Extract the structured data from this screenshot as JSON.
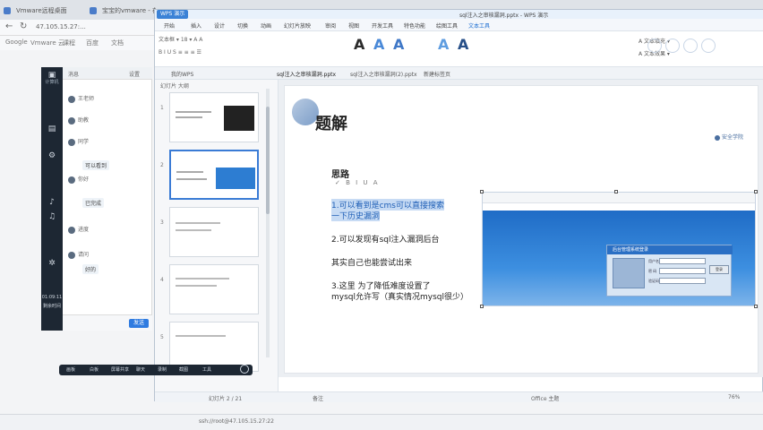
{
  "browser": {
    "tabs": [
      "Vmware远程桌面",
      "宝宝的vmware - 在线课程",
      "搜索..."
    ],
    "address": "47.105.15.27:...",
    "bookmarks": [
      "Google",
      "Vmware 云",
      "课程",
      "百度",
      "文档",
      "Vmware"
    ],
    "status": "ssh://root@47.105.15.27:22"
  },
  "remote_sidebar": {
    "items": [
      {
        "label": "计算机",
        "icon": "monitor-icon"
      },
      {
        "label": "文件",
        "icon": "folder-icon"
      },
      {
        "label": "进程",
        "icon": "process-icon"
      },
      {
        "label": "音量",
        "icon": "speaker-icon"
      },
      {
        "label": "音乐",
        "icon": "music-icon"
      },
      {
        "label": "设置",
        "icon": "gear-icon"
      }
    ],
    "time": "01:09:11",
    "time_label": "剩余时间"
  },
  "chat": {
    "header_left": "消息",
    "header_right": "设置",
    "rows": [
      "王老师",
      "助教",
      "同学",
      "你好",
      "进度",
      "请问"
    ],
    "bubbles": [
      "可以看到",
      "已完成",
      "好的"
    ],
    "send": "发送"
  },
  "wps": {
    "app_name": "WPS 演示",
    "doc_title": "sql注入之审核漏洞.pptx - WPS 演示",
    "menu": [
      "开始",
      "插入",
      "设计",
      "切换",
      "动画",
      "幻灯片放映",
      "审阅",
      "视图",
      "开发工具",
      "特色功能",
      "绘图工具",
      "文本工具"
    ],
    "menu_active": "文本工具",
    "style_letters": [
      "A",
      "A",
      "A",
      "A",
      "A"
    ],
    "style_colors": [
      "#2b2b2b",
      "#4a89d8",
      "#3f78c7",
      "#5f9de0",
      "#274f88"
    ],
    "doc_tabs": [
      "我的WPS",
      "sql注入之审核漏洞.pptx",
      "sql注入之审核漏洞(2).pptx",
      "新建标签页"
    ],
    "pane_tabs": "幻灯片  大纲",
    "thumb_numbers": [
      "1",
      "2",
      "3",
      "4",
      "5"
    ],
    "status_left": "幻灯片 2 / 21",
    "status_mid": "备注",
    "status_right": "Office 主题",
    "zoom": "76%"
  },
  "slide": {
    "title": "题解",
    "logo_text": "安全学院",
    "subtitle": "思路",
    "format_bar": "✓ B I U A",
    "bullets": [
      "1.可以看到是cms可以直接搜索",
      "  一下历史漏洞",
      "2.可以发现有sql注入漏洞后台",
      "其实自己也能尝试出来",
      "3.这里 为了降低难度设置了",
      "mysql允许写（真实情况mysql很少）"
    ],
    "login_title": "后台管理系统登录",
    "login_user_label": "用户名",
    "login_pass_label": "密 码",
    "login_code_label": "验证码",
    "login_button": "登录"
  },
  "float_toolbar": {
    "items": [
      "画板",
      "白板",
      "屏幕共享",
      "聊天",
      "录制",
      "截图",
      "工具"
    ]
  },
  "colors": {
    "accent": "#3b82d6",
    "highlight": "#c7dbf4",
    "sidebar": "#1d2733"
  }
}
